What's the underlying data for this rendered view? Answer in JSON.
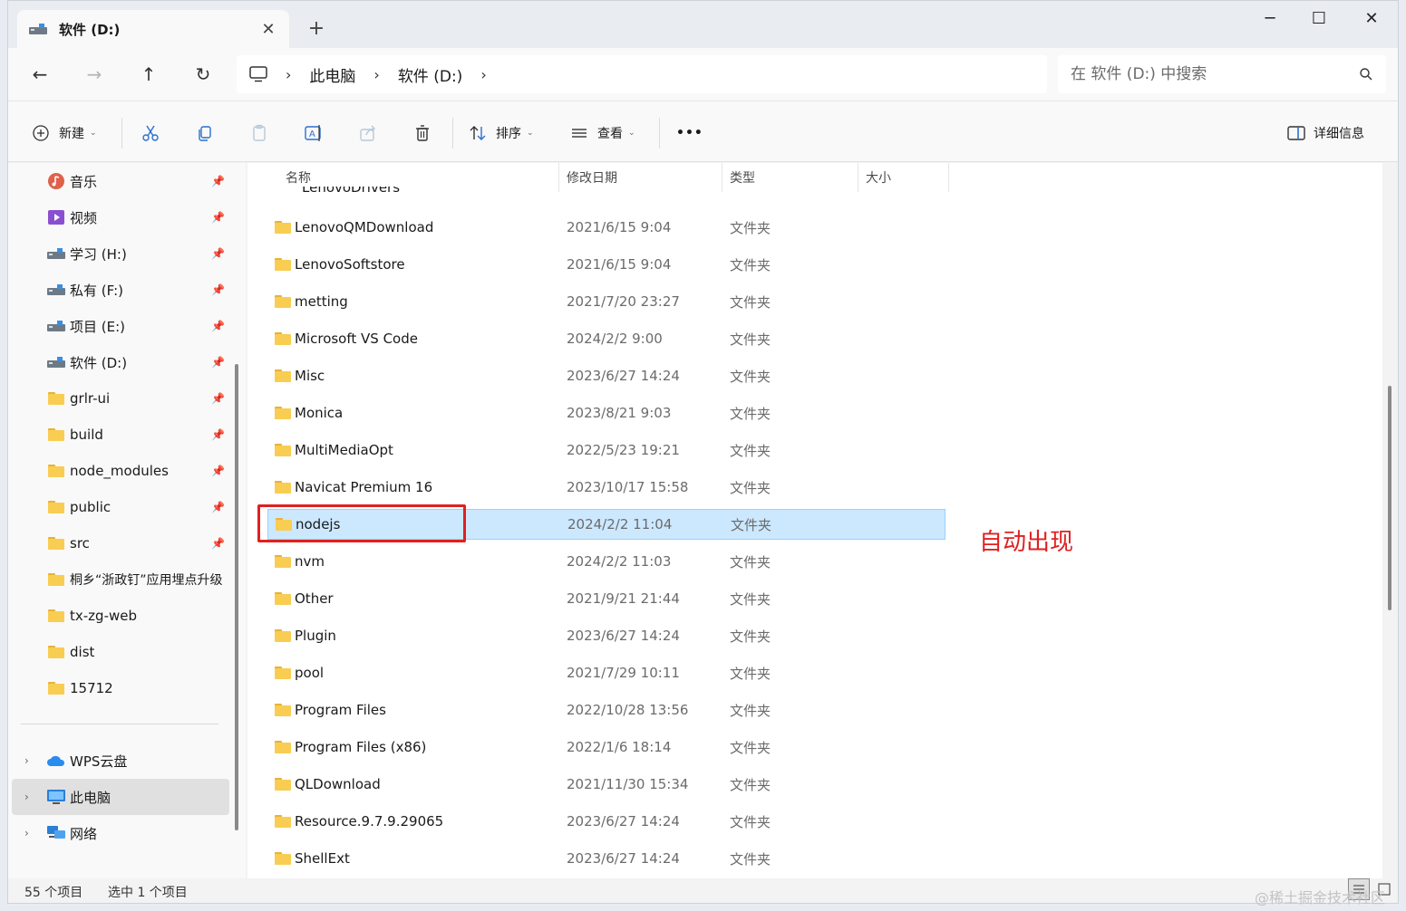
{
  "window": {
    "tab_title": "软件 (D:)",
    "tab_close": "✕",
    "new_tab": "+",
    "minimize": "─",
    "maximize": "☐",
    "close": "✕"
  },
  "nav": {
    "back": "←",
    "forward": "→",
    "up": "↑",
    "refresh": "↻",
    "breadcrumb": [
      "此电脑",
      "软件 (D:)"
    ],
    "separator": "›",
    "search_placeholder": "在 软件 (D:) 中搜索"
  },
  "toolbar": {
    "new_label": "新建",
    "sort_label": "排序",
    "view_label": "查看",
    "more": "•••",
    "details_label": "详细信息"
  },
  "sidebar": {
    "items": [
      {
        "label": "音乐",
        "icon": "music-icon"
      },
      {
        "label": "视频",
        "icon": "video-icon"
      },
      {
        "label": "学习 (H:)",
        "icon": "drive-icon"
      },
      {
        "label": "私有 (F:)",
        "icon": "drive-icon"
      },
      {
        "label": "项目 (E:)",
        "icon": "drive-icon"
      },
      {
        "label": "软件 (D:)",
        "icon": "drive-icon"
      },
      {
        "label": "grlr-ui",
        "icon": "folder-icon"
      },
      {
        "label": "build",
        "icon": "folder-icon"
      },
      {
        "label": "node_modules",
        "icon": "folder-icon"
      },
      {
        "label": "public",
        "icon": "folder-icon"
      },
      {
        "label": "src",
        "icon": "folder-icon"
      },
      {
        "label": "桐乡“浙政钉”应用埋点升级",
        "icon": "folder-icon"
      },
      {
        "label": "tx-zg-web",
        "icon": "folder-icon"
      },
      {
        "label": "dist",
        "icon": "folder-icon"
      },
      {
        "label": "15712",
        "icon": "folder-icon"
      }
    ],
    "locations": [
      {
        "label": "WPS云盘",
        "icon": "cloud-icon"
      },
      {
        "label": "此电脑",
        "icon": "pc-icon"
      },
      {
        "label": "网络",
        "icon": "network-icon"
      }
    ],
    "pin": "📌",
    "expand": "›"
  },
  "columns": {
    "name": "名称",
    "modified": "修改日期",
    "type": "类型",
    "size": "大小",
    "sort_arrow": "⌃"
  },
  "partial_row": "LenovoDrivers",
  "files": [
    {
      "name": "LenovoQMDownload",
      "date": "2021/6/15 9:04",
      "type": "文件夹"
    },
    {
      "name": "LenovoSoftstore",
      "date": "2021/6/15 9:04",
      "type": "文件夹"
    },
    {
      "name": "metting",
      "date": "2021/7/20 23:27",
      "type": "文件夹"
    },
    {
      "name": "Microsoft VS Code",
      "date": "2024/2/2 9:00",
      "type": "文件夹"
    },
    {
      "name": "Misc",
      "date": "2023/6/27 14:24",
      "type": "文件夹"
    },
    {
      "name": "Monica",
      "date": "2023/8/21 9:03",
      "type": "文件夹"
    },
    {
      "name": "MultiMediaOpt",
      "date": "2022/5/23 19:21",
      "type": "文件夹"
    },
    {
      "name": "Navicat Premium 16",
      "date": "2023/10/17 15:58",
      "type": "文件夹"
    },
    {
      "name": "nodejs",
      "date": "2024/2/2 11:04",
      "type": "文件夹",
      "selected": true
    },
    {
      "name": "nvm",
      "date": "2024/2/2 11:03",
      "type": "文件夹"
    },
    {
      "name": "Other",
      "date": "2021/9/21 21:44",
      "type": "文件夹"
    },
    {
      "name": "Plugin",
      "date": "2023/6/27 14:24",
      "type": "文件夹"
    },
    {
      "name": "pool",
      "date": "2021/7/29 10:11",
      "type": "文件夹"
    },
    {
      "name": "Program Files",
      "date": "2022/10/28 13:56",
      "type": "文件夹"
    },
    {
      "name": "Program Files (x86)",
      "date": "2022/1/6 18:14",
      "type": "文件夹"
    },
    {
      "name": "QLDownload",
      "date": "2021/11/30 15:34",
      "type": "文件夹"
    },
    {
      "name": "Resource.9.7.9.29065",
      "date": "2023/6/27 14:24",
      "type": "文件夹"
    },
    {
      "name": "ShellExt",
      "date": "2023/6/27 14:24",
      "type": "文件夹"
    }
  ],
  "annotation": "自动出现",
  "status": {
    "item_count": "55 个项目",
    "selection": "选中 1 个项目"
  },
  "watermark": "@稀土掘金技术社区"
}
